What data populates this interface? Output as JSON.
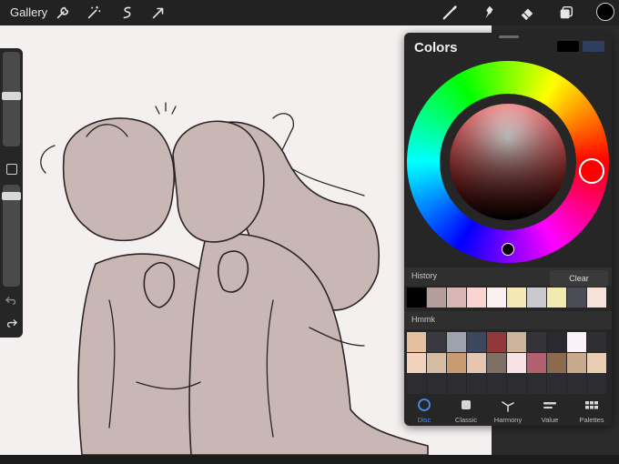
{
  "toolbar": {
    "gallery_label": "Gallery",
    "left_tools": [
      "wrench-icon",
      "magic-wand-icon",
      "selection-icon",
      "transform-arrow-icon"
    ],
    "right_tools": [
      "brush-icon",
      "smudge-icon",
      "eraser-icon",
      "layers-icon"
    ],
    "current_color": "#000000"
  },
  "sidebar": {
    "brush_size_level": 0.58,
    "opacity_level": 0.12,
    "undo_icon": "undo-icon",
    "redo_icon": "redo-icon"
  },
  "colors_panel": {
    "title": "Colors",
    "primary_color": "#000000",
    "secondary_color": "#2f3d5e",
    "hue_color": "#ff0000",
    "history": {
      "label": "History",
      "clear_label": "Clear",
      "swatches": [
        "#000000",
        "#b59d9a",
        "#d9b6b5",
        "#fbd4d2",
        "#faf0ef",
        "#f3e8b6",
        "#c9c8cf",
        "#f2ebb0",
        "#4a4d55",
        "#f8e1d8"
      ]
    },
    "palette": {
      "label": "Hmmk",
      "row1": [
        "#e4c0a0",
        "#3a3940",
        "#9ea2ac",
        "#3c465c",
        "#923838",
        "#cdb59b",
        "#34333a",
        "#2a2930",
        "#fbf1f8",
        "#2f2e33"
      ],
      "row2": [
        "#f3d2bd",
        "#d5bba2",
        "#c89b73",
        "#e6c5b3",
        "#7f6f64",
        "#f7e3e6",
        "#b26070",
        "#8c6a4d",
        "#c8a98b",
        "#e8cdb0"
      ],
      "row3": [
        "#2d2d31",
        "#2d2d31",
        "#2d2d31",
        "#2d2d31",
        "#2d2d31",
        "#2d2d31",
        "#2d2d31",
        "#2d2d31",
        "#2d2d31",
        "#2d2d31"
      ]
    },
    "tabs": [
      {
        "label": "Disc",
        "icon": "disc-icon"
      },
      {
        "label": "Classic",
        "icon": "classic-square-icon"
      },
      {
        "label": "Harmony",
        "icon": "harmony-icon"
      },
      {
        "label": "Value",
        "icon": "value-sliders-icon"
      },
      {
        "label": "Palettes",
        "icon": "palettes-grid-icon"
      }
    ],
    "active_tab": "Disc"
  },
  "colors": {
    "accent": "#4a8ff5",
    "toolbar_bg": "#222222",
    "panel_bg": "#262626",
    "canvas_bg": "#f5f0f0"
  }
}
